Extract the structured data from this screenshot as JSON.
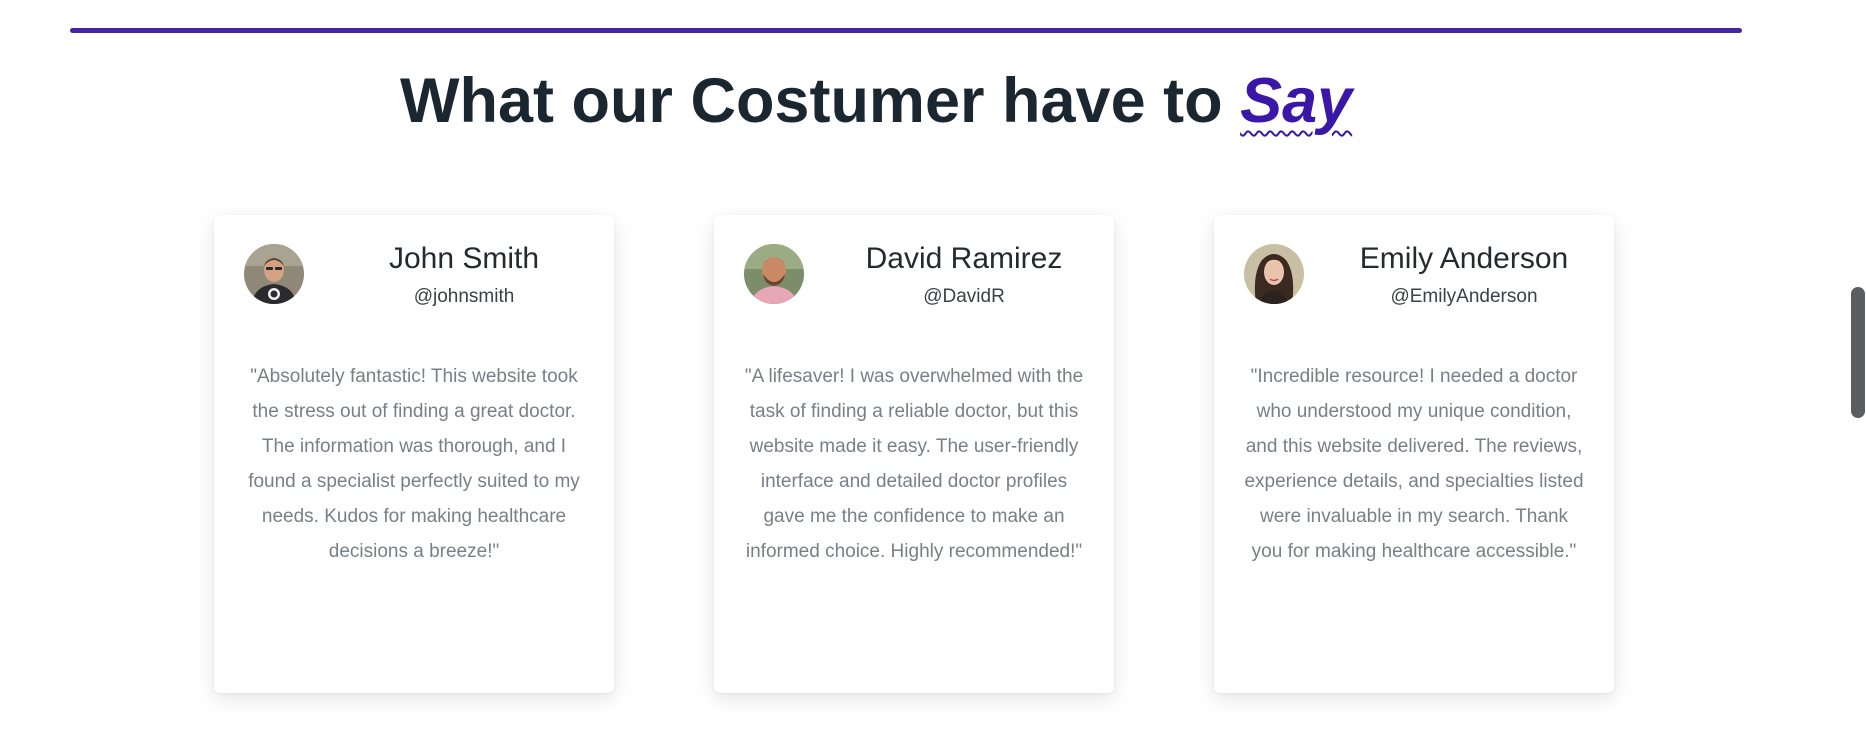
{
  "section": {
    "heading_prefix": "What our Costumer have to ",
    "heading_accent": "Say",
    "accent_color": "#3a17a6",
    "rule_color": "#4524a8"
  },
  "testimonials": [
    {
      "name": "John Smith",
      "handle": "@johnsmith",
      "quote": "\"Absolutely fantastic! This website took the stress out of finding a great doctor. The information was thorough, and I found a specialist perfectly suited to my needs. Kudos for making healthcare decisions a breeze!\""
    },
    {
      "name": "David Ramirez",
      "handle": "@DavidR",
      "quote": "\"A lifesaver! I was overwhelmed with the task of finding a reliable doctor, but this website made it easy. The user-friendly interface and detailed doctor profiles gave me the confidence to make an informed choice. Highly recommended!\""
    },
    {
      "name": "Emily Anderson",
      "handle": "@EmilyAnderson",
      "quote": "\"Incredible resource! I needed a doctor who understood my unique condition, and this website delivered. The reviews, experience details, and specialties listed were invaluable in my search. Thank you for making healthcare accessible.\""
    }
  ]
}
